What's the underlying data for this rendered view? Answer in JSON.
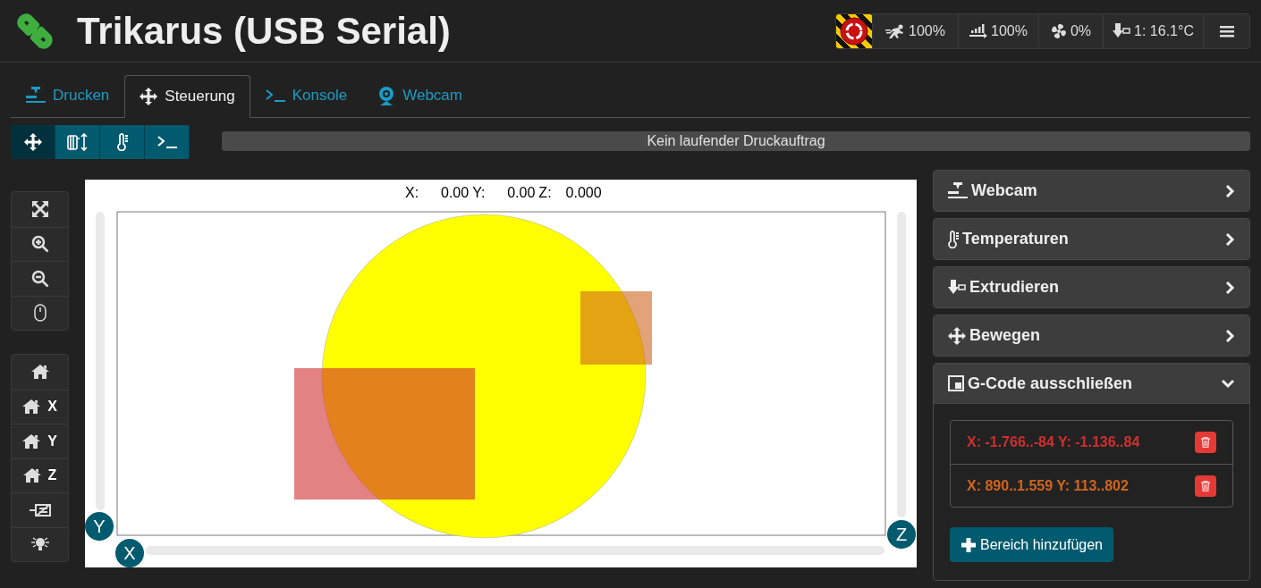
{
  "header": {
    "title": "Trikarus (USB Serial)"
  },
  "status_buttons": [
    "100%",
    "100%",
    "0%",
    "1: 16.1°C"
  ],
  "tabs": [
    {
      "label": "Drucken",
      "selected": false
    },
    {
      "label": "Steuerung",
      "selected": true
    },
    {
      "label": "Konsole",
      "selected": false
    },
    {
      "label": "Webcam",
      "selected": false
    }
  ],
  "sub_tools": [
    {
      "selected": true
    },
    {
      "selected": false
    },
    {
      "selected": false
    },
    {
      "selected": false
    }
  ],
  "progress": {
    "text": "Kein laufender Druckauftrag",
    "level": 0
  },
  "coordinates": [
    {
      "label": "X:",
      "value": "0.00"
    },
    {
      "label": "Y:",
      "value": "0.00"
    },
    {
      "label": "Z:",
      "value": "0.000"
    }
  ],
  "home_axes": [
    "X",
    "Y",
    "Z"
  ],
  "axis_handles": [
    "Y",
    "X",
    "Z"
  ],
  "panels": [
    {
      "title": "Webcam",
      "expanded": false
    },
    {
      "title": "Temperaturen",
      "expanded": false
    },
    {
      "title": "Extrudieren",
      "expanded": false
    },
    {
      "title": "Bewegen",
      "expanded": false
    },
    {
      "title": "G-Code ausschließen",
      "expanded": true
    }
  ],
  "exclusions": [
    {
      "text": "X: -1.766..-84 Y: -1.136..84",
      "color": "#d02f2f"
    },
    {
      "text": "X: 890..1.559 Y: 113..802",
      "color": "#d0651f"
    }
  ],
  "add_button": "Bereich hinzufügen"
}
